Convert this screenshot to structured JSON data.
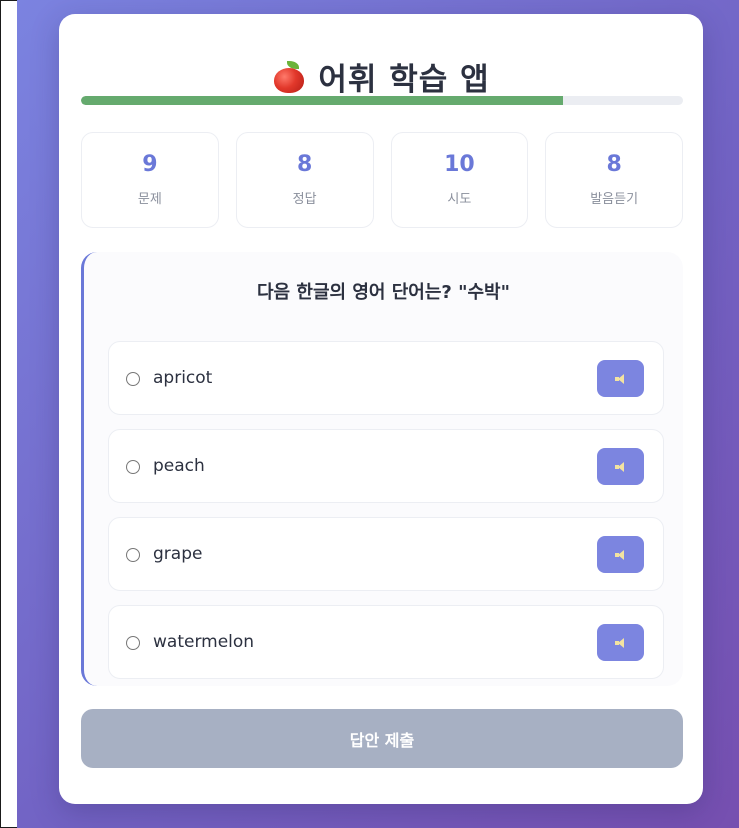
{
  "app": {
    "title": "어휘 학습 앱",
    "title_icon": "apple-icon",
    "progress_fraction": 0.8
  },
  "stats": [
    {
      "value": "9",
      "label": "문제"
    },
    {
      "value": "8",
      "label": "정답"
    },
    {
      "value": "10",
      "label": "시도"
    },
    {
      "value": "8",
      "label": "발음듣기"
    }
  ],
  "quiz": {
    "question": "다음 한글의 영어 단어는? \"수박\"",
    "options": [
      {
        "text": "apricot",
        "speak_icon": "speaker-icon"
      },
      {
        "text": "peach",
        "speak_icon": "speaker-icon"
      },
      {
        "text": "grape",
        "speak_icon": "speaker-icon"
      },
      {
        "text": "watermelon",
        "speak_icon": "speaker-icon"
      }
    ]
  },
  "submit": {
    "label": "답안 제출",
    "disabled": true
  },
  "colors": {
    "accent": "#6a78d8",
    "progress": "#65aa6e",
    "submit_disabled": "#a7b0c3",
    "background_gradient_start": "#7b83e0",
    "background_gradient_end": "#764fb0"
  }
}
